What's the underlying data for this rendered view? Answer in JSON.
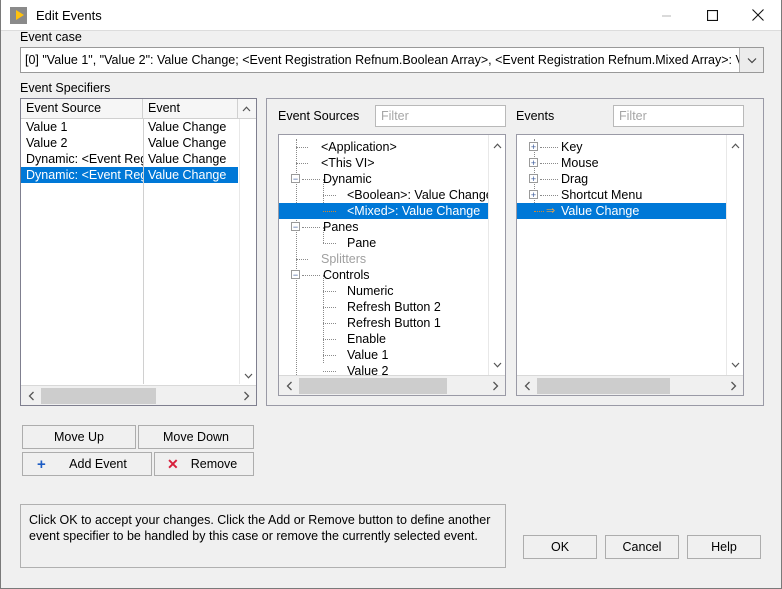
{
  "window": {
    "title": "Edit Events",
    "icon": "labview-run-icon",
    "controls": {
      "minimize": "minimize-icon",
      "maximize": "maximize-icon",
      "close": "close-icon"
    }
  },
  "colors": {
    "selection": "#0078d7",
    "dialog_bg": "#f0f0f0",
    "field_bg": "#ffffff",
    "accent_plus": "#1c5cc4",
    "accent_remove": "#d8203c",
    "tree_arrow": "#c8761f",
    "disabled_text": "#a0a0a0"
  },
  "event_case": {
    "label": "Event case",
    "value": "[0] \"Value 1\", \"Value 2\": Value Change;  <Event Registration Refnum.Boolean Array>, <Event Registration Refnum.Mixed Array>: Value",
    "dropdown_icon": "chevron-down-icon"
  },
  "specifiers": {
    "label": "Event Specifiers",
    "columns": [
      "Event Source",
      "Event"
    ],
    "scroll_up_icon": "chevron-up-icon",
    "scroll_down_icon": "chevron-down-icon",
    "scroll_left_icon": "chevron-left-icon",
    "scroll_right_icon": "chevron-right-icon",
    "rows": [
      {
        "source": "Value 1",
        "event": "Value Change",
        "selected": false
      },
      {
        "source": "Value 2",
        "event": "Value Change",
        "selected": false
      },
      {
        "source": "Dynamic: <Event Reg",
        "event": "Value Change",
        "selected": false
      },
      {
        "source": "Dynamic: <Event Reg",
        "event": "Value Change",
        "selected": true
      }
    ]
  },
  "event_sources": {
    "label": "Event Sources",
    "filter_placeholder": "Filter",
    "filter_value": "",
    "scroll_up_icon": "chevron-up-icon",
    "scroll_down_icon": "chevron-down-icon",
    "scroll_left_icon": "chevron-left-icon",
    "scroll_right_icon": "chevron-right-icon",
    "nodes": [
      {
        "label": "<Application>",
        "depth": 1,
        "toggle": "none",
        "selected": false,
        "dim": false
      },
      {
        "label": "<This VI>",
        "depth": 1,
        "toggle": "none",
        "selected": false,
        "dim": false
      },
      {
        "label": "Dynamic",
        "depth": 1,
        "toggle": "minus",
        "selected": false,
        "dim": false
      },
      {
        "label": "<Boolean>: Value Change",
        "depth": 2,
        "toggle": "none",
        "selected": false,
        "dim": false
      },
      {
        "label": "<Mixed>: Value Change",
        "depth": 2,
        "toggle": "none",
        "selected": true,
        "dim": false
      },
      {
        "label": "Panes",
        "depth": 1,
        "toggle": "minus",
        "selected": false,
        "dim": false
      },
      {
        "label": "Pane",
        "depth": 2,
        "toggle": "none",
        "selected": false,
        "dim": false
      },
      {
        "label": "Splitters",
        "depth": 1,
        "toggle": "none",
        "selected": false,
        "dim": true
      },
      {
        "label": "Controls",
        "depth": 1,
        "toggle": "minus",
        "selected": false,
        "dim": false
      },
      {
        "label": "Numeric",
        "depth": 2,
        "toggle": "none",
        "selected": false,
        "dim": false
      },
      {
        "label": "Refresh Button 2",
        "depth": 2,
        "toggle": "none",
        "selected": false,
        "dim": false
      },
      {
        "label": "Refresh Button 1",
        "depth": 2,
        "toggle": "none",
        "selected": false,
        "dim": false
      },
      {
        "label": "Enable",
        "depth": 2,
        "toggle": "none",
        "selected": false,
        "dim": false
      },
      {
        "label": "Value 1",
        "depth": 2,
        "toggle": "none",
        "selected": false,
        "dim": false
      },
      {
        "label": "Value 2",
        "depth": 2,
        "toggle": "none",
        "selected": false,
        "dim": false
      }
    ]
  },
  "events": {
    "label": "Events",
    "filter_placeholder": "Filter",
    "filter_value": "",
    "scroll_up_icon": "chevron-up-icon",
    "scroll_down_icon": "chevron-down-icon",
    "scroll_left_icon": "chevron-left-icon",
    "scroll_right_icon": "chevron-right-icon",
    "nodes": [
      {
        "label": "Key",
        "depth": 1,
        "toggle": "plus",
        "selected": false,
        "arrow": false
      },
      {
        "label": "Mouse",
        "depth": 1,
        "toggle": "plus",
        "selected": false,
        "arrow": false
      },
      {
        "label": "Drag",
        "depth": 1,
        "toggle": "plus",
        "selected": false,
        "arrow": false
      },
      {
        "label": "Shortcut Menu",
        "depth": 1,
        "toggle": "plus",
        "selected": false,
        "arrow": false
      },
      {
        "label": "Value Change",
        "depth": 1,
        "toggle": "none",
        "selected": true,
        "arrow": true
      }
    ]
  },
  "actions": {
    "move_up": "Move Up",
    "move_down": "Move Down",
    "add_event": "Add Event",
    "add_event_icon": "plus-icon",
    "remove": "Remove",
    "remove_icon": "x-icon"
  },
  "help": {
    "text": "Click OK to accept your changes.  Click the Add or Remove button to define another event specifier to be handled by this case or remove the currently selected event."
  },
  "footer": {
    "ok": "OK",
    "cancel": "Cancel",
    "help": "Help"
  }
}
